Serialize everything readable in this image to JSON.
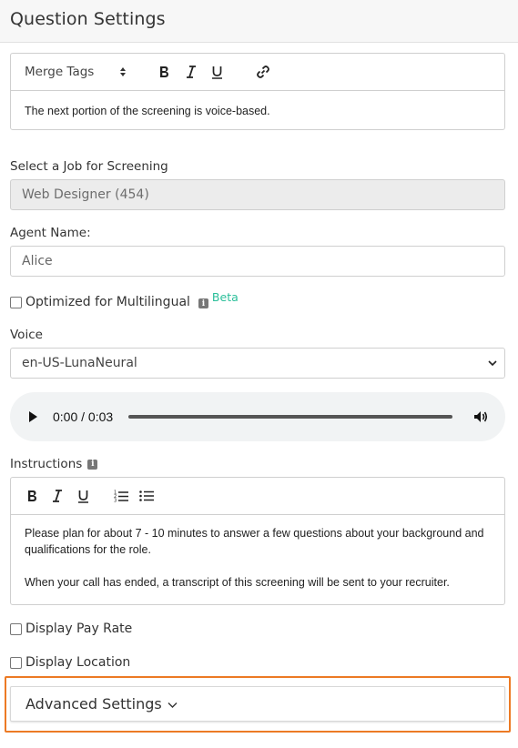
{
  "header": {
    "title": "Question Settings"
  },
  "message_editor": {
    "merge_tags_label": "Merge Tags",
    "text": "The next portion of the screening is voice-based."
  },
  "job": {
    "label": "Select a Job for Screening",
    "value": "Web Designer (454)"
  },
  "agent": {
    "label": "Agent Name:",
    "value": "Alice"
  },
  "multilingual": {
    "label": "Optimized for Multilingual",
    "badge": "Beta",
    "checked": false
  },
  "voice": {
    "label": "Voice",
    "selected": "en-US-LunaNeural"
  },
  "audio": {
    "time": "0:00 / 0:03",
    "progress": 0.0
  },
  "instructions": {
    "label": "Instructions",
    "paragraph1": "Please plan for about 7 - 10 minutes to answer a few questions about your background and qualifications for the role.",
    "paragraph2": "When your call has ended, a transcript of this screening will be sent to your recruiter."
  },
  "options": {
    "pay_rate": "Display Pay Rate",
    "location": "Display Location"
  },
  "advanced": {
    "label": "Advanced Settings"
  },
  "colors": {
    "accent_outline": "#ec7a24",
    "beta": "#2bbf9a"
  }
}
